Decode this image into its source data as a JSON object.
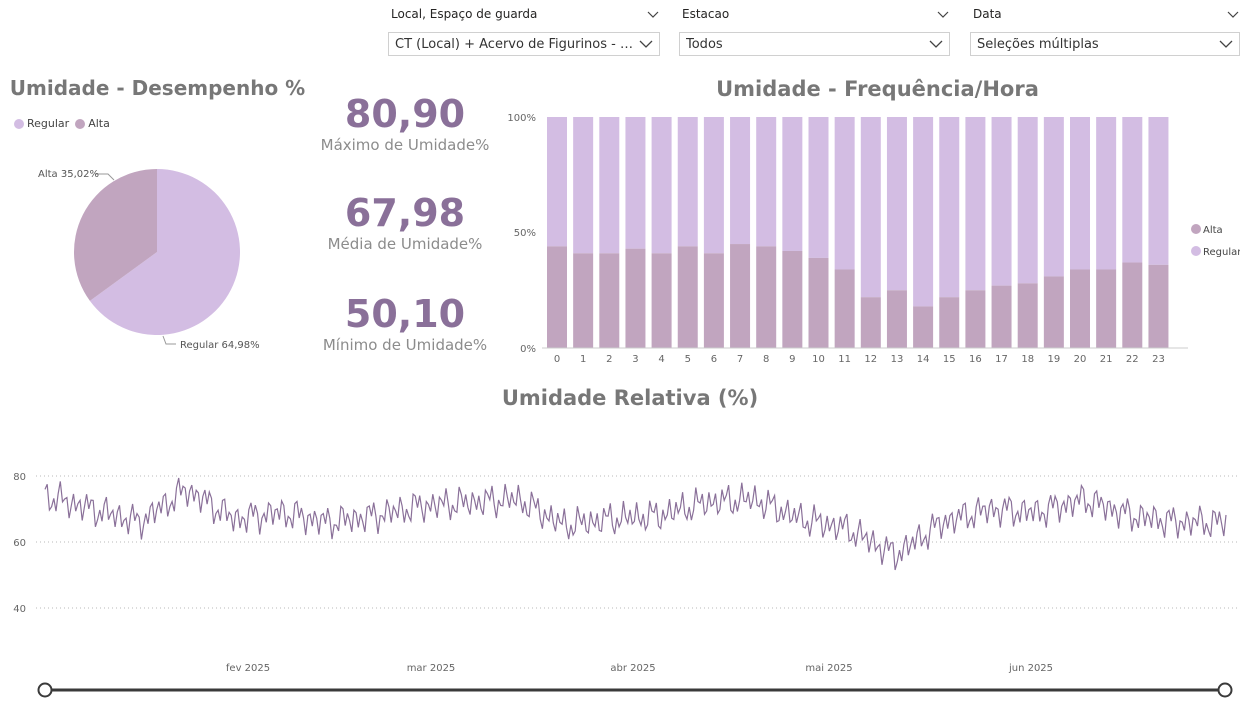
{
  "colors": {
    "regular": "#d3bde3",
    "alta": "#c1a5bf",
    "line": "#8a7099",
    "kpi": "#8a7099",
    "title": "#777777"
  },
  "slicers": [
    {
      "label": "Local, Espaço de guarda",
      "value": "CT (Local) + Acervo de Figurinos - Mezan..."
    },
    {
      "label": "Estacao",
      "value": "Todos"
    },
    {
      "label": "Data",
      "value": "Seleções múltiplas"
    }
  ],
  "pie": {
    "title": "Umidade - Desempenho %",
    "legend": [
      {
        "name": "Regular"
      },
      {
        "name": "Alta"
      }
    ],
    "labels": {
      "alta": "Alta 35,02%",
      "regular": "Regular 64,98%"
    }
  },
  "kpis": [
    {
      "value": "80,90",
      "label": "Máximo de Umidade%"
    },
    {
      "value": "67,98",
      "label": "Média de Umidade%"
    },
    {
      "value": "50,10",
      "label": "Mínimo de Umidade%"
    }
  ],
  "bar": {
    "title": "Umidade - Frequência/Hora",
    "yticks": [
      "100%",
      "50%",
      "0%"
    ],
    "legend": [
      {
        "name": "Alta"
      },
      {
        "name": "Regular"
      }
    ]
  },
  "line": {
    "title": "Umidade Relativa (%)",
    "yticks": [
      "80",
      "60",
      "40"
    ],
    "xticks": [
      "fev 2025",
      "mar 2025",
      "abr 2025",
      "mai 2025",
      "jun 2025"
    ]
  },
  "chart_data": [
    {
      "type": "pie",
      "title": "Umidade - Desempenho %",
      "slices": [
        {
          "name": "Regular",
          "value": 64.98
        },
        {
          "name": "Alta",
          "value": 35.02
        }
      ]
    },
    {
      "type": "bar",
      "stacked": true,
      "title": "Umidade - Frequência/Hora",
      "categories": [
        "0",
        "1",
        "2",
        "3",
        "4",
        "5",
        "6",
        "7",
        "8",
        "9",
        "10",
        "11",
        "12",
        "13",
        "14",
        "15",
        "16",
        "17",
        "18",
        "19",
        "20",
        "21",
        "22",
        "23"
      ],
      "ylim": [
        0,
        100
      ],
      "series": [
        {
          "name": "Alta",
          "values": [
            44,
            41,
            41,
            43,
            41,
            44,
            41,
            45,
            44,
            42,
            39,
            34,
            22,
            25,
            18,
            22,
            25,
            27,
            28,
            31,
            34,
            34,
            37,
            36
          ]
        },
        {
          "name": "Regular",
          "values": [
            56,
            59,
            59,
            57,
            59,
            56,
            59,
            55,
            56,
            58,
            61,
            66,
            78,
            75,
            82,
            78,
            75,
            73,
            72,
            69,
            66,
            66,
            63,
            64
          ]
        }
      ]
    },
    {
      "type": "line",
      "title": "Umidade Relativa (%)",
      "x": [
        "2025-01-01",
        "2025-01-15",
        "2025-02-01",
        "2025-02-15",
        "2025-03-01",
        "2025-03-15",
        "2025-04-01",
        "2025-04-15",
        "2025-05-01",
        "2025-05-15",
        "2025-06-01",
        "2025-06-15",
        "2025-06-30"
      ],
      "ylim": [
        40,
        80
      ],
      "grid": true,
      "series": [
        {
          "name": "",
          "values": [
            74,
            70,
            66,
            76,
            67,
            69,
            66,
            68,
            71,
            72,
            73,
            65,
            67,
            68,
            72,
            73,
            67,
            64,
            56,
            66,
            70,
            69,
            73,
            68,
            66,
            66
          ]
        }
      ]
    }
  ]
}
